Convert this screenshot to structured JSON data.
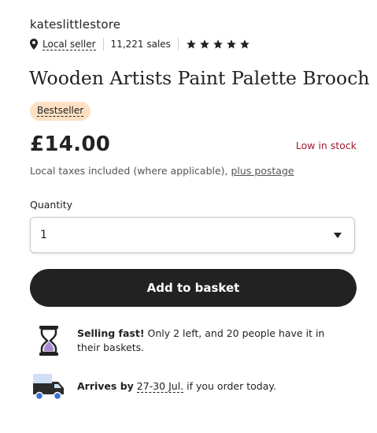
{
  "shop": {
    "name": "kateslittlestore",
    "local_seller_label": "Local seller",
    "sales": "11,221 sales",
    "rating_stars": 5
  },
  "product": {
    "title": "Wooden Artists Paint Palette Brooch",
    "badge": "Bestseller",
    "price": "£14.00",
    "stock_status": "Low in stock",
    "taxes_text": "Local taxes included (where applicable),",
    "postage_link": "plus postage"
  },
  "quantity": {
    "label": "Quantity",
    "selected": "1"
  },
  "actions": {
    "add_to_basket": "Add to basket"
  },
  "selling_fast": {
    "bold": "Selling fast!",
    "text": "Only 2 left, and 20 people have it in their baskets."
  },
  "delivery": {
    "prefix": "Arrives by",
    "dates": "27-30 Jul.",
    "suffix": "if you order today."
  },
  "colors": {
    "stock_red": "#a61a2e",
    "badge_bg": "#fde0c4",
    "button_bg": "#222222",
    "hourglass_sand": "#a98bd1",
    "truck_cab": "#2b2b2b",
    "truck_cargo": "#cfe0f5",
    "wheel_blue": "#3f6fd6"
  },
  "icons": [
    "location-pin-icon",
    "star-icon",
    "chevron-down-icon",
    "hourglass-icon",
    "delivery-truck-icon"
  ]
}
